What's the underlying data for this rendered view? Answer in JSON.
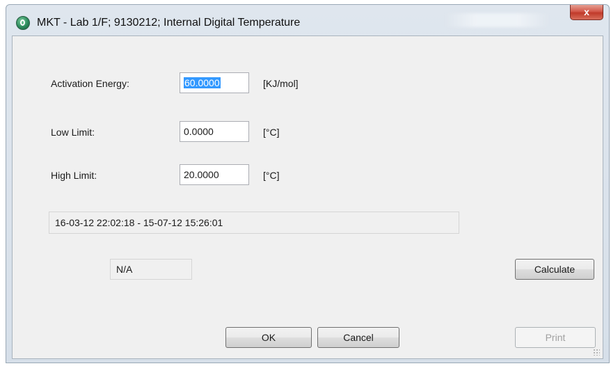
{
  "window": {
    "title": "MKT - Lab 1/F; 9130212; Internal Digital Temperature",
    "close_glyph": "x",
    "icon": "app-logo-icon"
  },
  "form": {
    "activation_energy": {
      "label": "Activation Energy:",
      "value": "60.0000",
      "unit": "[KJ/mol]"
    },
    "low_limit": {
      "label": "Low Limit:",
      "value": "0.0000",
      "unit": "[°C]"
    },
    "high_limit": {
      "label": "High Limit:",
      "value": "20.0000",
      "unit": "[°C]"
    },
    "date_range": "16-03-12 22:02:18 - 15-07-12 15:26:01",
    "result": "N/A"
  },
  "buttons": {
    "calculate": "Calculate",
    "ok": "OK",
    "cancel": "Cancel",
    "print": "Print"
  },
  "colors": {
    "selection": "#3399ff",
    "close_button": "#c03a2a",
    "dialog_background": "#f0f0f0"
  }
}
